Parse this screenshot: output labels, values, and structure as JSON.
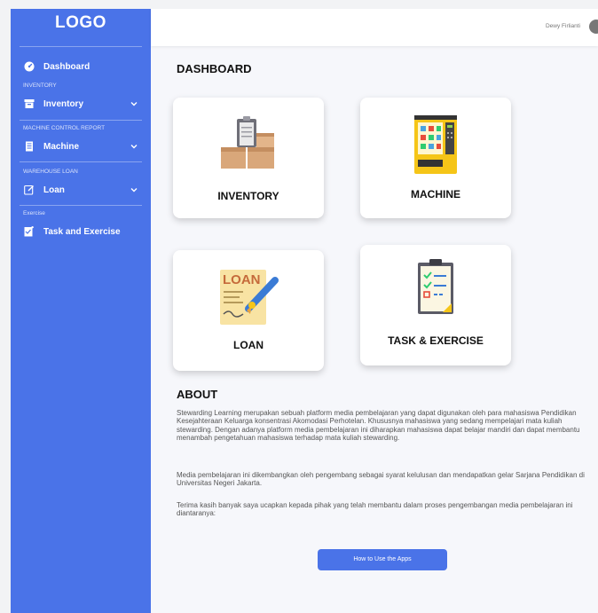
{
  "sidebar": {
    "logo": "LOGO",
    "dashboard": "Dashboard",
    "sections": {
      "inventory": "INVENTORY",
      "machine": "MACHINE CONTROL REPORT",
      "loan": "WAREHOUSE LOAN",
      "exercise": "Exercise"
    },
    "items": {
      "inventory": "Inventory",
      "machine": "Machine",
      "loan": "Loan",
      "task": "Task and Exercise"
    }
  },
  "header": {
    "user_name": "Dewy Firlianti"
  },
  "main": {
    "title": "DASHBOARD",
    "cards": {
      "inventory": "INVENTORY",
      "machine": "MACHINE",
      "loan": "LOAN",
      "task": "TASK & EXERCISE"
    },
    "loan_icon_text": "LOAN",
    "about": {
      "title": "ABOUT",
      "p1": "Stewarding Learning merupakan sebuah platform media pembelajaran yang dapat digunakan oleh para mahasiswa Pendidikan Kesejahteraan Keluarga konsentrasi Akomodasi Perhotelan. Khususnya mahasiswa yang sedang mempelajari mata kuliah stewarding. Dengan adanya platform media pembelajaran ini diharapkan mahasiswa dapat belajar mandiri dan dapat membantu menambah pengetahuan mahasiswa terhadap mata kuliah stewarding.",
      "p2": "Media pembelajaran ini dikembangkan oleh pengembang sebagai syarat kelulusan dan mendapatkan gelar Sarjana Pendidikan di Universitas Negeri Jakarta.",
      "p3": "Terima kasih banyak saya ucapkan kepada pihak yang telah membantu dalam proses pengembangan media pembelajaran ini diantaranya:"
    },
    "how_button": "How to Use the Apps"
  }
}
